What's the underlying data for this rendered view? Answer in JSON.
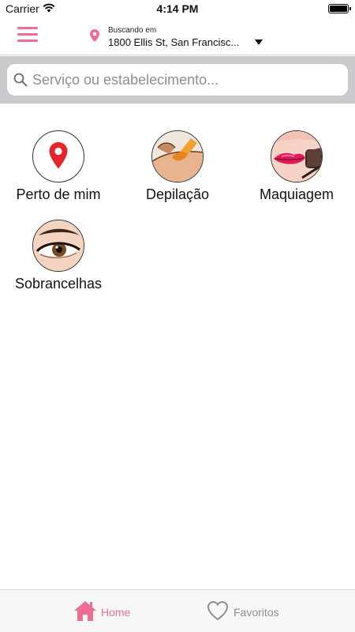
{
  "status_bar": {
    "carrier": "Carrier",
    "time": "4:14 PM"
  },
  "header": {
    "location_label": "Buscando em",
    "location_address": "1800 Ellis St, San Francisc..."
  },
  "search": {
    "placeholder": "Serviço ou estabelecimento..."
  },
  "categories": [
    {
      "label": "Perto de mim",
      "icon": "map-pin-icon"
    },
    {
      "label": "Depilação",
      "icon": "waxing-image"
    },
    {
      "label": "Maquiagem",
      "icon": "makeup-image"
    },
    {
      "label": "Sobrancelhas",
      "icon": "eyebrow-image"
    }
  ],
  "tabs": [
    {
      "label": "Home",
      "icon": "home-icon",
      "active": true
    },
    {
      "label": "Favoritos",
      "icon": "heart-icon",
      "active": false
    }
  ],
  "colors": {
    "accent": "#ee6e93",
    "pin_red": "#e8242b",
    "inactive": "#8e8e93",
    "search_bg": "#c9c9ce"
  }
}
